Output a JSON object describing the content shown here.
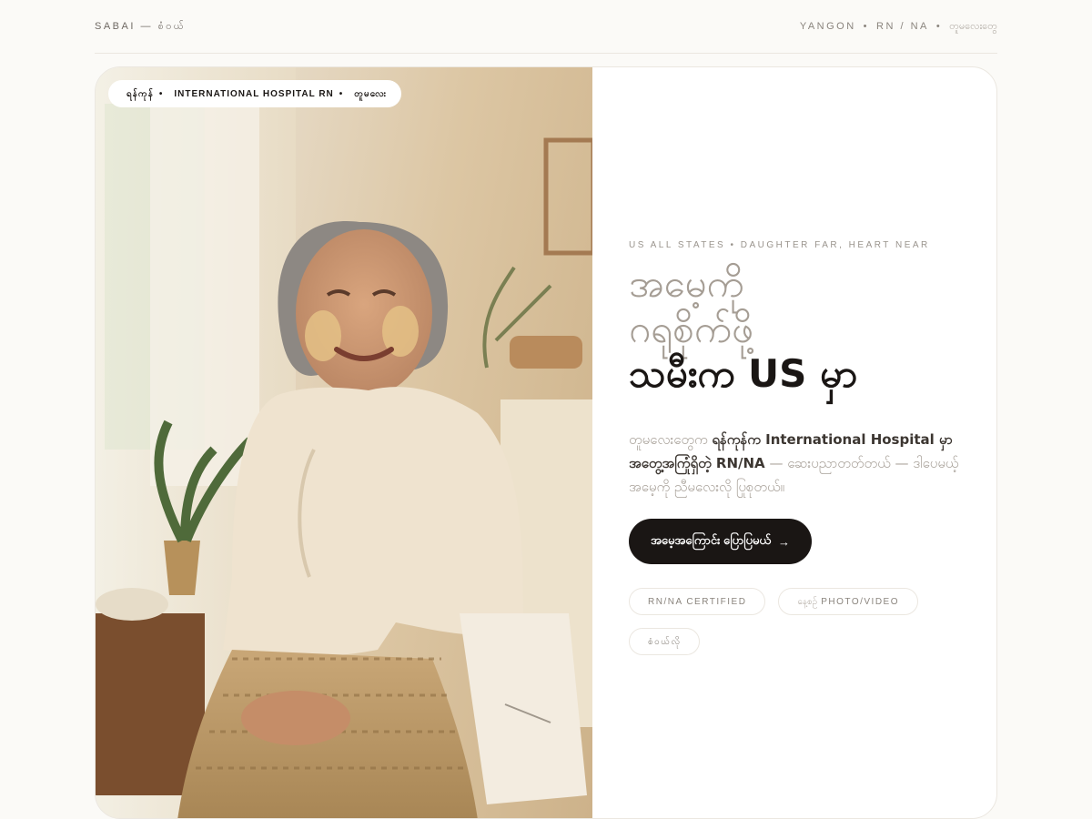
{
  "header": {
    "brand": "SABAI — စံဝယ်",
    "meta_city": "YANGON",
    "meta_role": "RN / NA",
    "meta_mm": "တူမလေးတွေ"
  },
  "hero": {
    "pill": {
      "location": "ရန်ကုန်",
      "credential": "INTERNATIONAL HOSPITAL RN",
      "tagline": "တူမလေး"
    },
    "eyebrow": "US ALL STATES • DAUGHTER FAR, HEART NEAR",
    "headline": {
      "line1": "အမေ့ကို",
      "line2": "ဂရုစိုက်ဖို့",
      "line3": "သမီးက US မှာ"
    },
    "lede": {
      "part1": "တူမလေးတွေက ",
      "bold": "ရန်ကုန်က International Hospital မှာ အတွေ့အကြုံရှိတဲ့ RN/NA",
      "part2": " — ဆေးပညာတတ်တယ် — ဒါပေမယ့် အမေ့ကို ညီမလေးလို ပြုစုတယ်။"
    },
    "cta_label": "အမေ့အကြောင်း ပြောပြမယ်",
    "cta_arrow": "→",
    "tags": [
      {
        "mm": "",
        "label": "RN/NA CERTIFIED"
      },
      {
        "mm": "နေ့စဉ်",
        "label": "PHOTO/VIDEO"
      },
      {
        "mm": "",
        "label": "စံဝယ်လို"
      }
    ]
  }
}
